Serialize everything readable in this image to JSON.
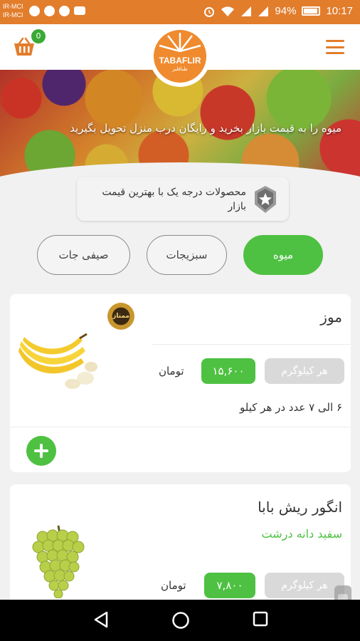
{
  "status_bar": {
    "carrier_1": "IR-MCI",
    "carrier_2": "IR-MCI",
    "battery": "94%",
    "time": "10:17",
    "icons": [
      "chat-icon",
      "whatsapp-icon",
      "vpn-icon",
      "youtube-icon",
      "alarm-icon",
      "wifi-icon",
      "signal-icon",
      "signal-4g-icon",
      "battery-icon"
    ]
  },
  "header": {
    "cart_count": "0",
    "logo_text": "TABAFLIR",
    "logo_sub": "طبافلیر"
  },
  "hero": {
    "text": "میوه را به قیمت بازار بخرید و رایگان درب منزل تحویل بگیرید"
  },
  "quality": {
    "text": "محصولات درجه یک با بهترین قیمت بازار"
  },
  "tabs": [
    {
      "label": "میوه",
      "active": true
    },
    {
      "label": "سبزیجات",
      "active": false
    },
    {
      "label": "صیفی جات",
      "active": false
    }
  ],
  "products": [
    {
      "name": "موز",
      "badge": "ممتاز",
      "unit": "هر کیلوگرم",
      "price": "۱۵,۶۰۰",
      "currency": "تومان",
      "description": "۶ الی ۷ عدد در هر کیلو"
    },
    {
      "name": "انگور ریش بابا",
      "subtitle": "سفید دانه درشت",
      "unit": "هر کیلوگرم",
      "price": "۷,۸۰۰",
      "currency": "تومان"
    }
  ],
  "colors": {
    "status_bar": "#e27d2c",
    "accent_green": "#4ec142",
    "brand_orange": "#ef8a2e"
  }
}
